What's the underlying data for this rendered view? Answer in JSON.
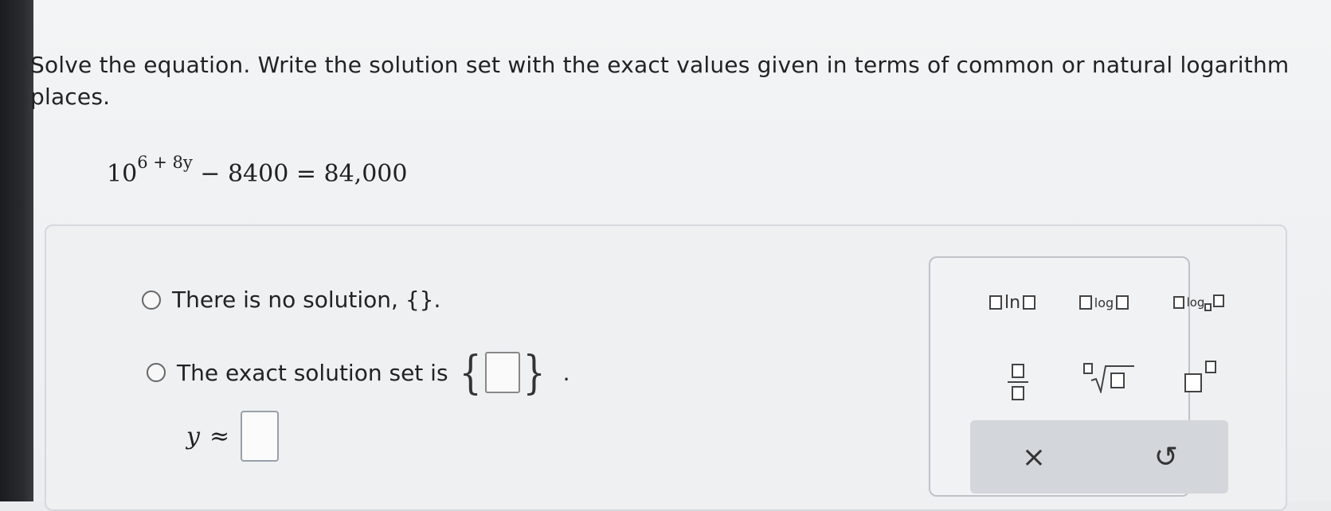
{
  "question": {
    "prompt_line1": "Solve the equation. Write the solution set with the exact values given in terms of common or natural logarithm",
    "prompt_line2": "places.",
    "equation": {
      "base": "10",
      "exponent": "6 + 8y",
      "rest": " − 8400 = 84,000"
    }
  },
  "options": [
    {
      "label": "There is no solution, {}."
    },
    {
      "label": "The exact solution set is"
    }
  ],
  "approx": {
    "variable": "y",
    "symbol": "≈"
  },
  "palette": {
    "ln_label": "ln",
    "log_label": "log",
    "logb_label": "log",
    "clear_symbol": "×",
    "undo_symbol": "↺"
  },
  "icons": [
    "ln-template-icon",
    "log-template-icon",
    "log-base-template-icon",
    "fraction-icon",
    "nth-root-icon",
    "exponent-icon",
    "clear-icon",
    "undo-icon"
  ]
}
